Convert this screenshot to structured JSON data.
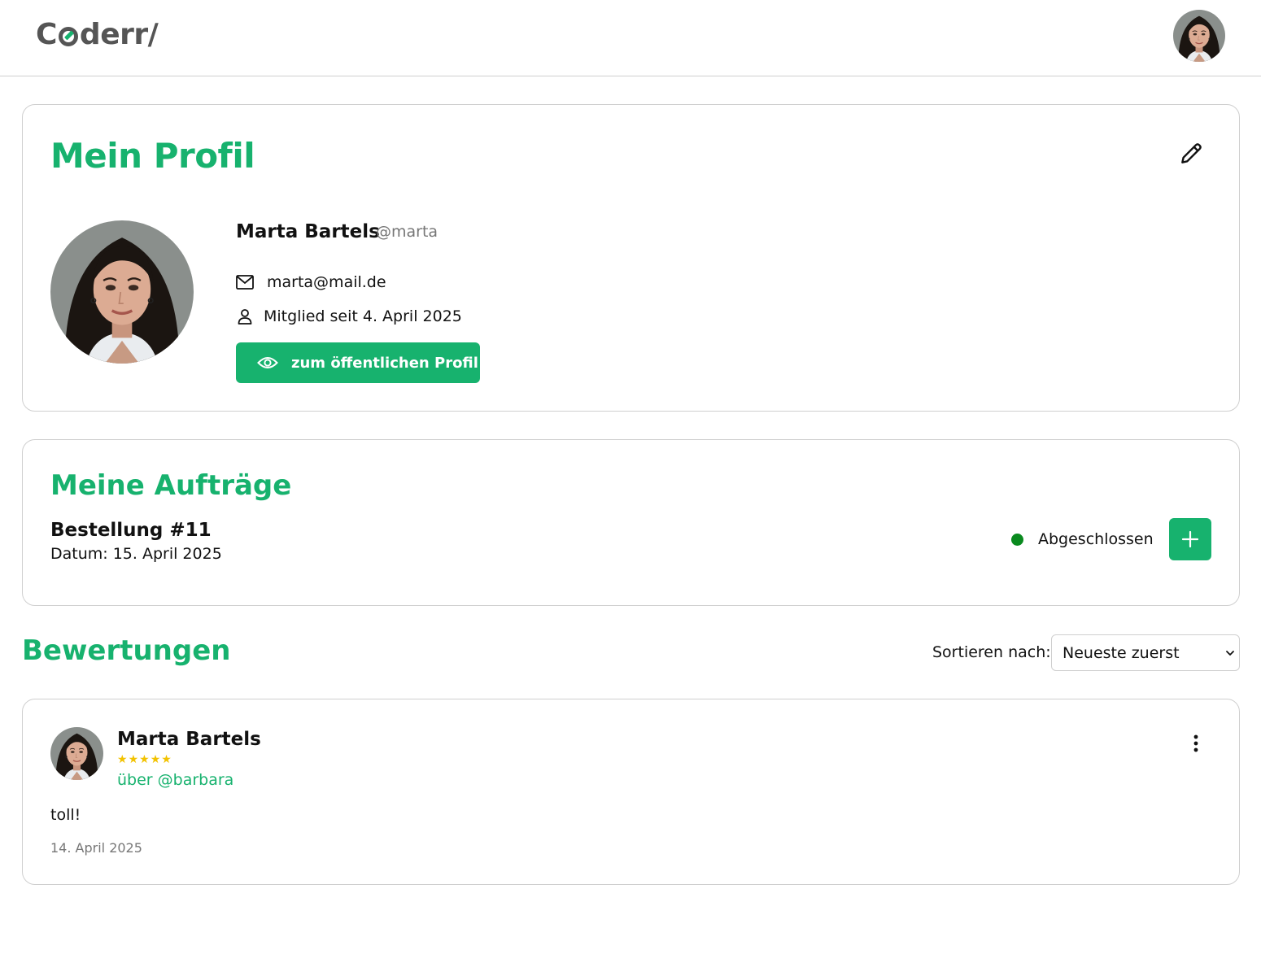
{
  "header": {
    "logo_text_prefix": "C",
    "logo_text_suffix": "derr/",
    "avatar_alt": "Marta Bartels"
  },
  "profile": {
    "title": "Mein Profil",
    "edit_icon": "pencil-icon",
    "name": "Marta Bartels",
    "handle": "@marta",
    "email": "marta@mail.de",
    "member_since": "Mitglied seit 4. April 2025",
    "public_profile_button": "zum öffentlichen Profil"
  },
  "orders": {
    "title": "Meine Aufträge",
    "items": [
      {
        "number": "Bestellung #11",
        "date": "Datum: 15. April 2025",
        "status": "Abgeschlossen",
        "status_color": "#0a8a1f"
      }
    ]
  },
  "reviews": {
    "title": "Bewertungen",
    "sort_label": "Sortieren nach:",
    "sort_selected": "Neueste zuerst",
    "items": [
      {
        "author": "Marta Bartels",
        "rating": 5,
        "about": "über @barbara",
        "text": "toll!",
        "date": "14. April 2025"
      }
    ]
  },
  "colors": {
    "accent": "#17b26e",
    "star": "#f2c200",
    "border": "#cfcfcf"
  }
}
